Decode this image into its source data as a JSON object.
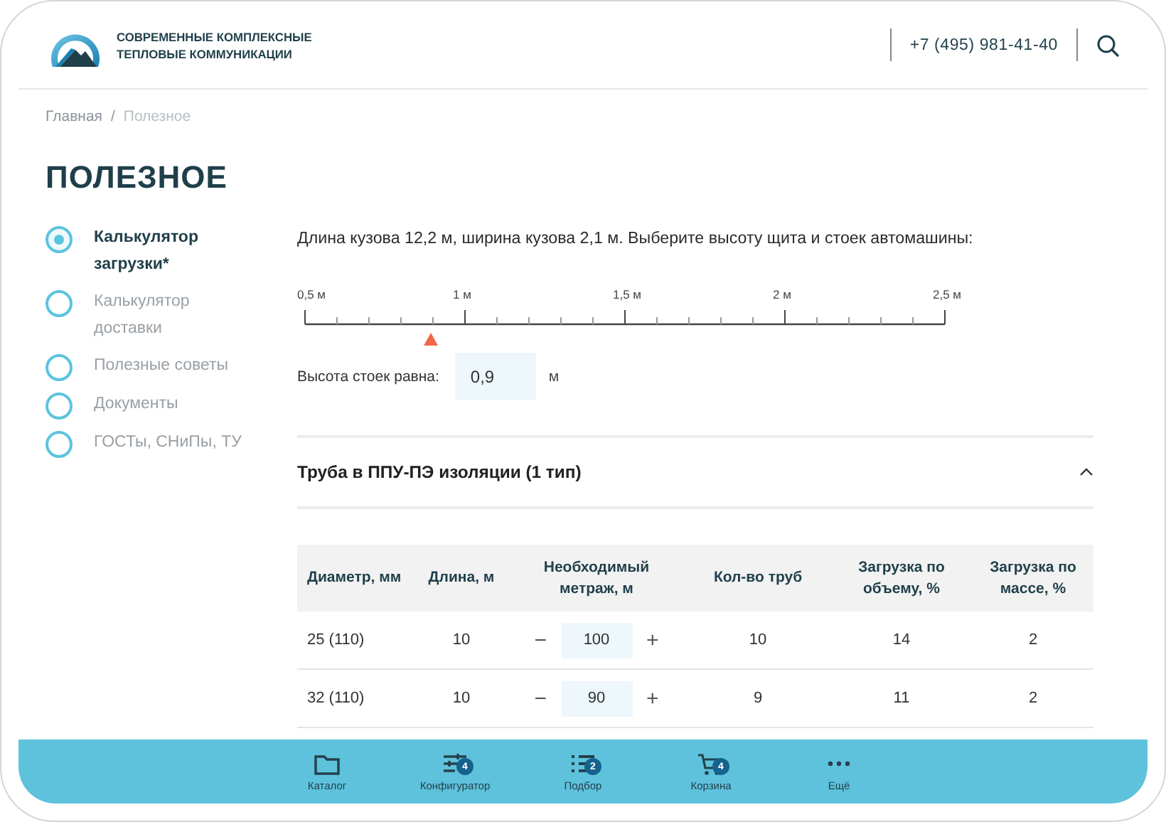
{
  "header": {
    "logo_lines": [
      "СОВРЕМЕННЫЕ КОМПЛЕКСНЫЕ",
      "ТЕПЛОВЫЕ КОММУНИКАЦИИ"
    ],
    "phone": "+7 (495) 981-41-40"
  },
  "breadcrumbs": {
    "separator": "/",
    "items": [
      {
        "label": "Главная",
        "current": false
      },
      {
        "label": "Полезное",
        "current": true
      }
    ]
  },
  "page_title": "ПОЛЕЗНОЕ",
  "sidebar": {
    "items": [
      {
        "label": "Калькулятор загрузки*",
        "selected": true
      },
      {
        "label": "Калькулятор доставки",
        "selected": false
      },
      {
        "label": "Полезные советы",
        "selected": false
      },
      {
        "label": "Документы",
        "selected": false
      },
      {
        "label": "ГОСТы, СНиПы, ТУ",
        "selected": false
      }
    ]
  },
  "calculator": {
    "description": "Длина кузова 12,2 м, ширина кузова 2,1 м. Выберите высоту щита и стоек автомашины:",
    "scale": {
      "labels": [
        "0,5 м",
        "1 м",
        "1,5 м",
        "2 м",
        "2,5 м"
      ],
      "level": 0.2
    },
    "height_label": "Высота стоек равна:",
    "height_value": "0,9",
    "height_unit": "м"
  },
  "accordion": {
    "title": "Труба в ППУ-ПЭ изоляции (1 тип)",
    "expanded": true
  },
  "table": {
    "decrement": "−",
    "increment": "+",
    "columns": [
      "Диаметр, мм",
      "Длина, м",
      "Необходимый метраж, м",
      "Кол-во труб",
      "Загрузка по объему, %",
      "Загрузка по массе, %"
    ],
    "rows": [
      {
        "diameter": "25 (110)",
        "length": "10",
        "meterage": "100",
        "pipes": "10",
        "load_volume": "14",
        "load_mass": "2"
      },
      {
        "diameter": "32 (110)",
        "length": "10",
        "meterage": "90",
        "pipes": "9",
        "load_volume": "11",
        "load_mass": "2"
      }
    ]
  },
  "bottom_bar": {
    "items": [
      {
        "kind": "folder",
        "label": "Каталог"
      },
      {
        "kind": "sliders",
        "label": "Конфигуратор",
        "badge": "4"
      },
      {
        "kind": "list",
        "label": "Подбор",
        "badge": "2"
      },
      {
        "kind": "cart",
        "label": "Корзина",
        "badge": "4"
      },
      {
        "kind": "more",
        "label": "Ещё"
      }
    ]
  }
}
